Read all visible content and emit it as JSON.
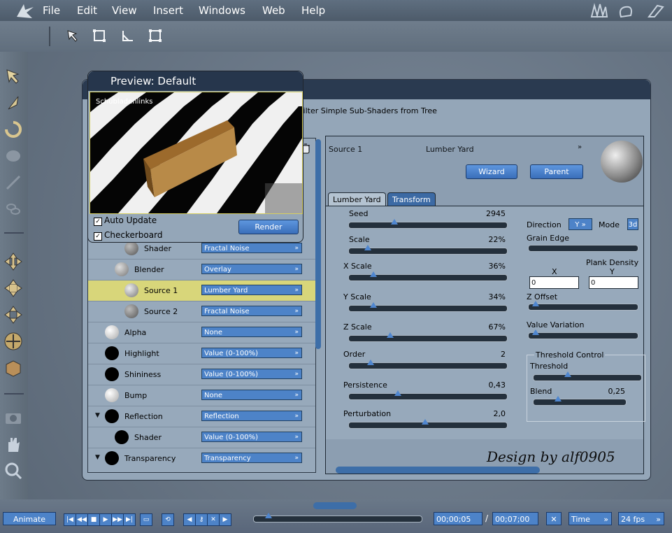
{
  "menubar": {
    "items": [
      "File",
      "Edit",
      "View",
      "Insert",
      "Windows",
      "Web",
      "Help"
    ]
  },
  "dialog": {
    "filter_text": "Filter Simple Sub-Shaders from Tree"
  },
  "preview": {
    "title": "Preview: Default",
    "overlay_text": "Schubladenlinks",
    "auto_update": "Auto Update",
    "checkerboard": "Checkerboard",
    "render": "Render"
  },
  "tree": {
    "rows": [
      {
        "label": "Shader",
        "value": "Fractal Noise"
      },
      {
        "label": "Blender",
        "value": "Overlay"
      },
      {
        "label": "Source 1",
        "value": "Lumber Yard"
      },
      {
        "label": "Source 2",
        "value": "Fractal Noise"
      },
      {
        "label": "Alpha",
        "value": "None"
      },
      {
        "label": "Highlight",
        "value": "Value (0-100%)"
      },
      {
        "label": "Shininess",
        "value": "Value (0-100%)"
      },
      {
        "label": "Bump",
        "value": "None"
      },
      {
        "label": "Reflection",
        "value": "Reflection"
      },
      {
        "label": "Shader",
        "value": "Value (0-100%)"
      },
      {
        "label": "Transparency",
        "value": "Transparency"
      }
    ]
  },
  "right": {
    "source_label": "Source 1",
    "source_value": "Lumber Yard",
    "wizard": "Wizard",
    "parent": "Parent",
    "tab_lumber": "Lumber Yard",
    "tab_transform": "Transform",
    "params": [
      {
        "label": "Seed",
        "value": "2945",
        "level": 0.28
      },
      {
        "label": "Scale",
        "value": "22%",
        "level": 0.1
      },
      {
        "label": "X Scale",
        "value": "36%",
        "level": 0.14
      },
      {
        "label": "Y Scale",
        "value": "34%",
        "level": 0.14
      },
      {
        "label": "Z Scale",
        "value": "67%",
        "level": 0.25
      },
      {
        "label": "Order",
        "value": "2",
        "level": 0.12
      },
      {
        "label": "Persistence",
        "value": "0,43",
        "level": 0.3
      },
      {
        "label": "Perturbation",
        "value": "2,0",
        "level": 0.48
      }
    ],
    "direction_label": "Direction",
    "direction_value": "Y",
    "mode_label": "Mode",
    "mode_value": "3d",
    "grain_edge": "Grain Edge",
    "plank_density": "Plank Density",
    "x_label": "X",
    "y_label": "Y",
    "x_value": "0",
    "y_value": "0",
    "z_offset": "Z Offset",
    "value_variation": "Value Variation",
    "threshold_control": "Threshold Control",
    "threshold": "Threshold",
    "blend": "Blend",
    "blend_value": "0,25",
    "design": "Design by alf0905"
  },
  "bottom": {
    "animate": "Animate",
    "current_time": "00;00;05",
    "separator": "/",
    "total_time": "00;07;00",
    "time_mode": "Time",
    "fps": "24 fps"
  },
  "colors": {
    "accent": "#4d83c8",
    "title": "#26364c",
    "selected_row": "#d8d67a"
  }
}
